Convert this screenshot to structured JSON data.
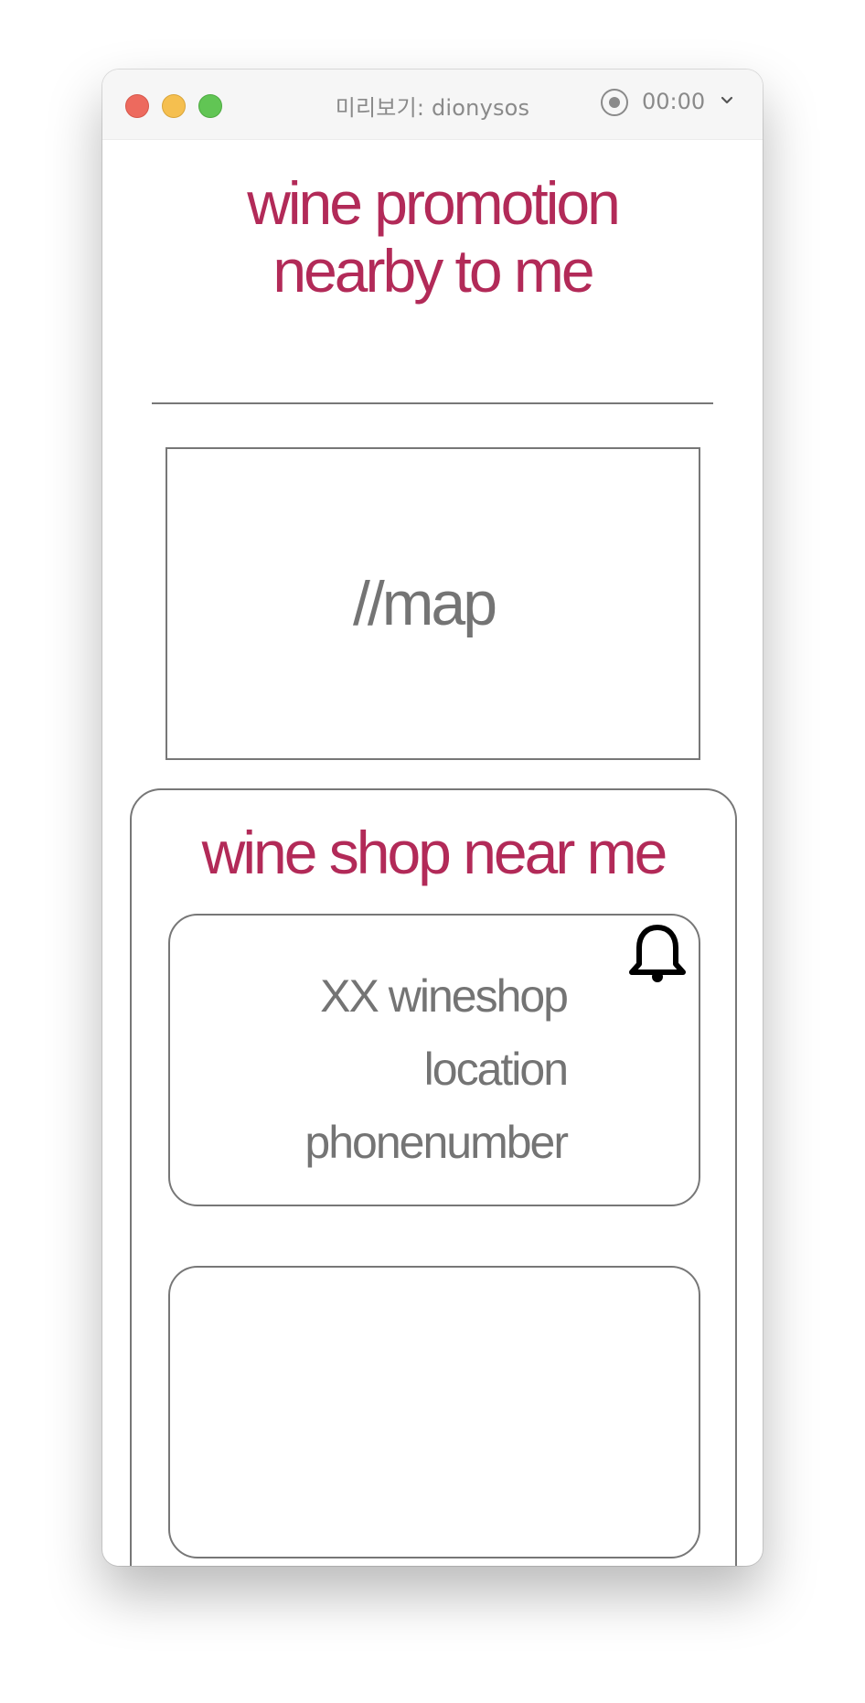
{
  "window": {
    "title": "미리보기: dionysos",
    "recording_time": "00:00"
  },
  "header": {
    "title_line1": "wine promotion",
    "title_line2": "nearby to me"
  },
  "map": {
    "placeholder": "//map"
  },
  "shops_section": {
    "title": "wine shop near me",
    "cards": [
      {
        "name": "XX wineshop",
        "location": "location",
        "phone": "phonenumber"
      }
    ]
  },
  "icons": {
    "notification": "bell-icon",
    "home": "home-icon"
  },
  "colors": {
    "accent": "#b22a58",
    "text_gray": "#747474",
    "border": "#777777"
  }
}
